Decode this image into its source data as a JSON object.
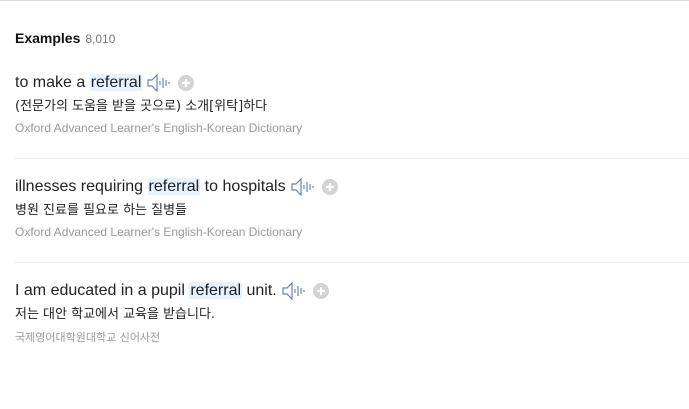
{
  "header": {
    "title": "Examples",
    "count": "8,010"
  },
  "examples": [
    {
      "before": "to make a ",
      "highlight": "referral",
      "after": "",
      "translation": "(전문가의 도움을 받을 곳으로) 소개[위탁]하다",
      "source": "Oxford Advanced Learner's English-Korean Dictionary"
    },
    {
      "before": "illnesses requiring ",
      "highlight": "referral",
      "after": " to hospitals",
      "translation": "병원 진료를 필요로 하는 질병들",
      "source": "Oxford Advanced Learner's English-Korean Dictionary"
    },
    {
      "before": "I am educated in a pupil ",
      "highlight": "referral",
      "after": " unit.",
      "translation": "저는 대안 학교에서 교육을 받습니다.",
      "source": "국제영어대학원대학교 신어사전"
    }
  ],
  "icons": {
    "speaker": "speaker-icon",
    "add": "plus-circle-icon"
  },
  "colors": {
    "highlight_bg": "#e6f2ff",
    "speaker_stroke": "#6b84a8",
    "add_bg": "#d4d4d4",
    "source_text": "#999999"
  }
}
